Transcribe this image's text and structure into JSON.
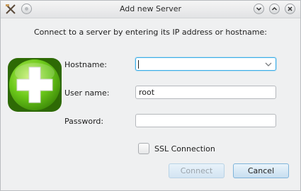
{
  "window": {
    "title": "Add new Server",
    "buttons": {
      "minimize_icon": "chevron-down-icon",
      "maximize_icon": "chevron-up-icon",
      "close_icon": "close-icon"
    }
  },
  "intro_text": "Connect to a server by entering its IP address or hostname:",
  "form": {
    "hostname_label": "Hostname:",
    "hostname_value": "",
    "username_label": "User name:",
    "username_value": "root",
    "password_label": "Password:",
    "password_value": "",
    "ssl_label": "SSL Connection",
    "ssl_checked": false
  },
  "buttons": {
    "connect": "Connect",
    "cancel": "Cancel"
  },
  "colors": {
    "focus_accent": "#3daee9",
    "plus_green": "#6cc91a",
    "window_bg": "#eff0f1"
  }
}
